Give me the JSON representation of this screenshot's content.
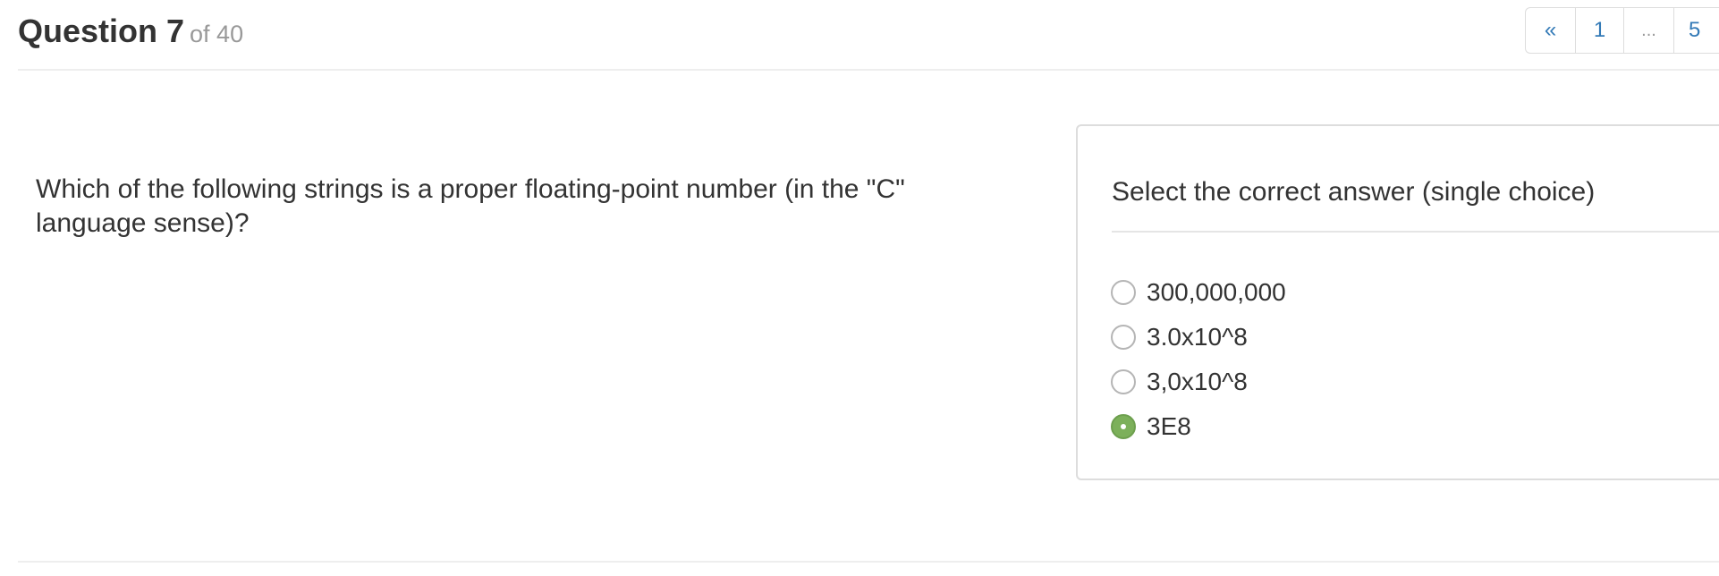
{
  "header": {
    "title": "Question 7",
    "of_text": "of 40"
  },
  "pagination": {
    "prev": "«",
    "first": "1",
    "ellipsis": "...",
    "page_5": "5"
  },
  "question": {
    "text": "Which of the following strings is a proper floating-point number (in the \"C\" language sense)?"
  },
  "answers": {
    "heading": "Select the correct answer (single choice)",
    "options": [
      {
        "label": "300,000,000",
        "selected": false
      },
      {
        "label": "3.0x10^8",
        "selected": false
      },
      {
        "label": "3,0x10^8",
        "selected": false
      },
      {
        "label": "3E8",
        "selected": true
      }
    ],
    "selected_color": "#7cb05a"
  }
}
